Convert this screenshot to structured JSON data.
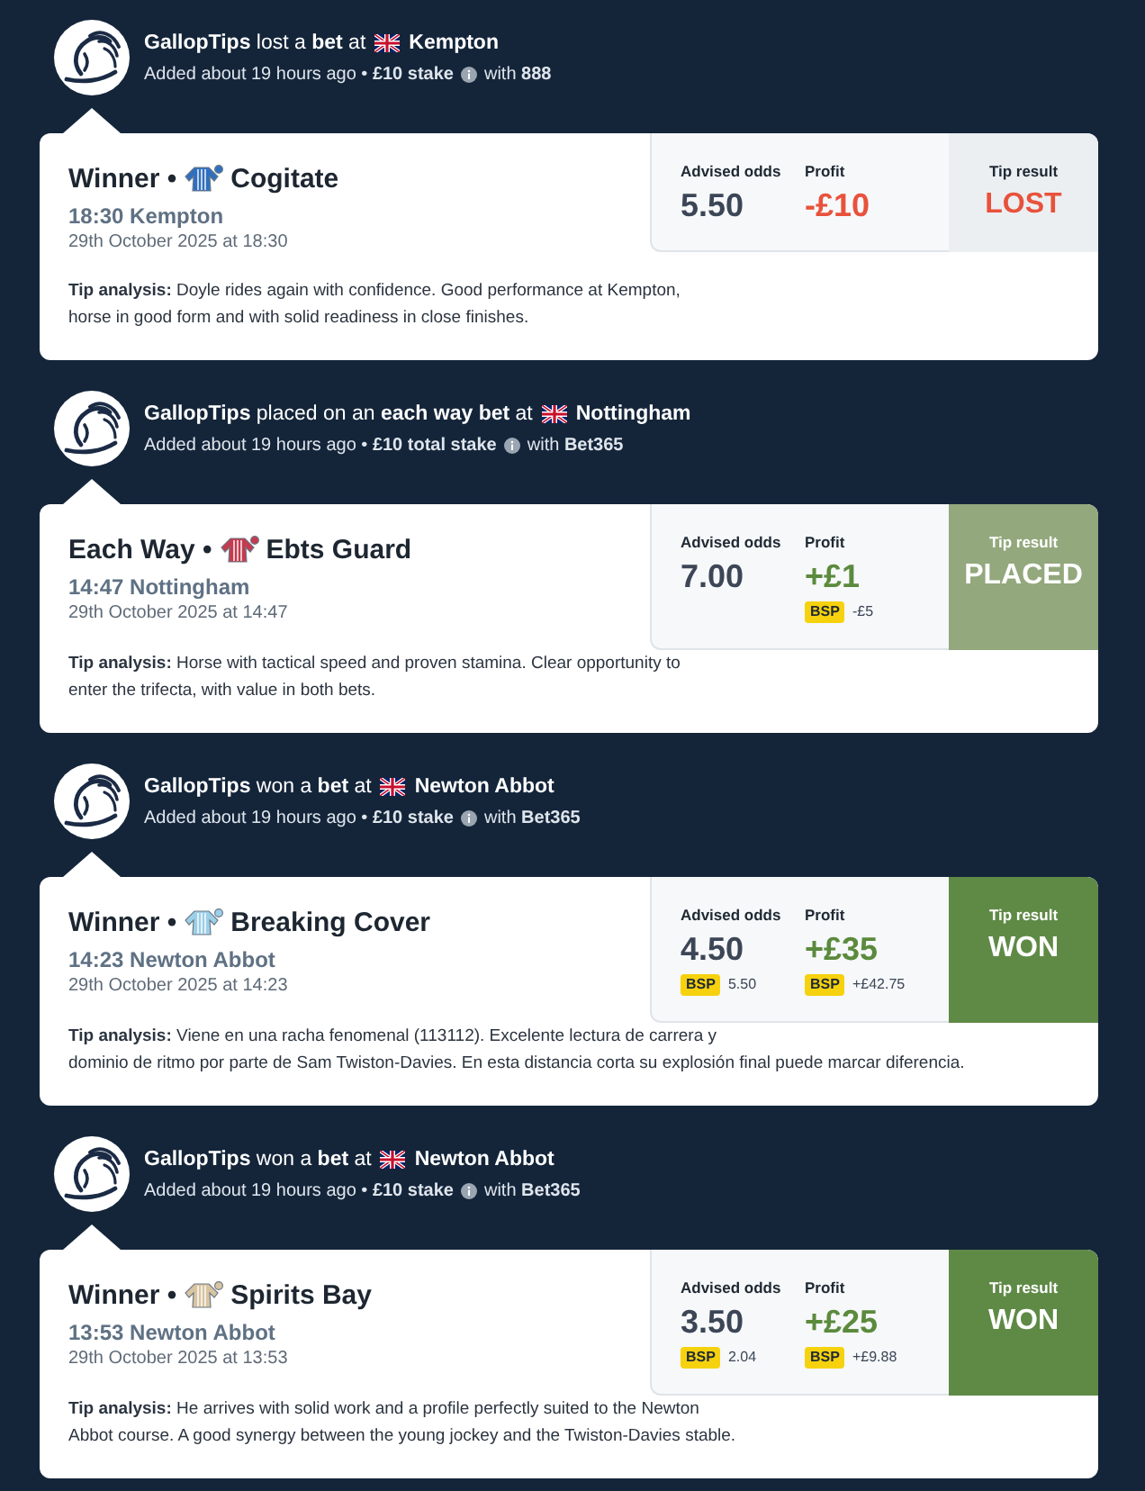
{
  "feed": [
    {
      "headline": "**GallopTips** lost a **bet** at",
      "venue": "Kempton",
      "meta": "Added about 19 hours ago • **£10 stake**",
      "bookmaker": "with **888**",
      "card": {
        "market": "Winner •",
        "silk": {
          "color": "#2f6fbf"
        },
        "horse": "Cogitate",
        "race": "18:30 Kempton",
        "date": "29th October 2025 at 18:30",
        "odds": {
          "label": "Advised odds",
          "value": "5.50"
        },
        "profit": {
          "label": "Profit",
          "value": "-£10"
        },
        "result": {
          "label": "Tip result",
          "value": "LOST",
          "kind": "lost"
        },
        "analysis": "**Tip analysis:** Doyle rides again with confidence. Good performance at Kempton,\nhorse in good form and with solid readiness in close finishes."
      }
    },
    {
      "headline": "**GallopTips** placed on an **each way bet** at",
      "venue": "Nottingham",
      "meta": "Added about 19 hours ago • **£10 total stake**",
      "bookmaker": "with **Bet365**",
      "card": {
        "market": "Each Way •",
        "silk": {
          "color": "#c43a4e"
        },
        "horse": "Ebts Guard",
        "race": "14:47 Nottingham",
        "date": "29th October 2025 at 14:47",
        "odds": {
          "label": "Advised odds",
          "value": "7.00"
        },
        "profit": {
          "label": "Profit",
          "value": "+£1",
          "bsp": {
            "badge": "BSP",
            "value": "-£5"
          }
        },
        "result": {
          "label": "Tip result",
          "value": "PLACED",
          "kind": "placed"
        },
        "analysis": "**Tip analysis:** Horse with tactical speed and proven stamina. Clear opportunity to\nenter the trifecta, with value in both bets."
      }
    },
    {
      "headline": "**GallopTips** won a **bet** at",
      "venue": "Newton Abbot",
      "meta": "Added about 19 hours ago • **£10 stake**",
      "bookmaker": "with **Bet365**",
      "card": {
        "market": "Winner •",
        "silk": {
          "color": "#9ccfe8"
        },
        "horse": "Breaking Cover",
        "race": "14:23 Newton Abbot",
        "date": "29th October 2025 at 14:23",
        "odds": {
          "label": "Advised odds",
          "value": "4.50",
          "bsp": {
            "badge": "BSP",
            "value": "5.50"
          }
        },
        "profit": {
          "label": "Profit",
          "value": "+£35",
          "bsp": {
            "badge": "BSP",
            "value": "+£42.75"
          }
        },
        "result": {
          "label": "Tip result",
          "value": "WON",
          "kind": "won"
        },
        "analysis": "**Tip analysis:** Viene en una racha fenomenal (113112). Excelente lectura de carrera y\ndominio de ritmo por parte de Sam Twiston-Davies. En esta distancia corta su explosión final puede marcar diferencia."
      }
    },
    {
      "headline": "**GallopTips** won a **bet** at",
      "venue": "Newton Abbot",
      "meta": "Added about 19 hours ago • **£10 stake**",
      "bookmaker": "with **Bet365**",
      "card": {
        "market": "Winner •",
        "silk": {
          "color": "#d8c4a0"
        },
        "horse": "Spirits Bay",
        "race": "13:53 Newton Abbot",
        "date": "29th October 2025 at 13:53",
        "odds": {
          "label": "Advised odds",
          "value": "3.50",
          "bsp": {
            "badge": "BSP",
            "value": "2.04"
          }
        },
        "profit": {
          "label": "Profit",
          "value": "+£25",
          "bsp": {
            "badge": "BSP",
            "value": "+£9.88"
          }
        },
        "result": {
          "label": "Tip result",
          "value": "WON",
          "kind": "won"
        },
        "analysis": "**Tip analysis:** He arrives with solid work and a profile perfectly suited to the Newton\nAbbot course. A good synergy between the young jockey and the Twiston-Davies stable."
      }
    }
  ]
}
